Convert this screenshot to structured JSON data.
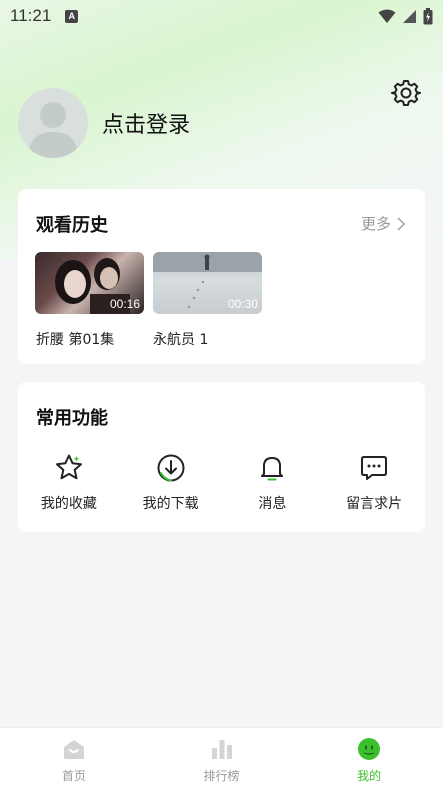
{
  "status_bar": {
    "time": "11:21",
    "notification_icon": "A"
  },
  "profile": {
    "login_text": "点击登录"
  },
  "history": {
    "title": "观看历史",
    "more_label": "更多",
    "items": [
      {
        "title": "折腰 第01集",
        "duration": "00:16"
      },
      {
        "title": "永航员 1",
        "duration": "00:30"
      }
    ]
  },
  "functions": {
    "title": "常用功能",
    "items": [
      {
        "label": "我的收藏",
        "icon": "star-icon"
      },
      {
        "label": "我的下载",
        "icon": "download-icon"
      },
      {
        "label": "消息",
        "icon": "bell-icon"
      },
      {
        "label": "留言求片",
        "icon": "chat-icon"
      }
    ]
  },
  "bottom_nav": {
    "items": [
      {
        "label": "首页",
        "icon": "home-icon"
      },
      {
        "label": "排行榜",
        "icon": "ranking-icon"
      },
      {
        "label": "我的",
        "icon": "profile-face-icon",
        "active": true
      }
    ]
  },
  "colors": {
    "accent": "#3bbf2c",
    "muted": "#999999"
  }
}
